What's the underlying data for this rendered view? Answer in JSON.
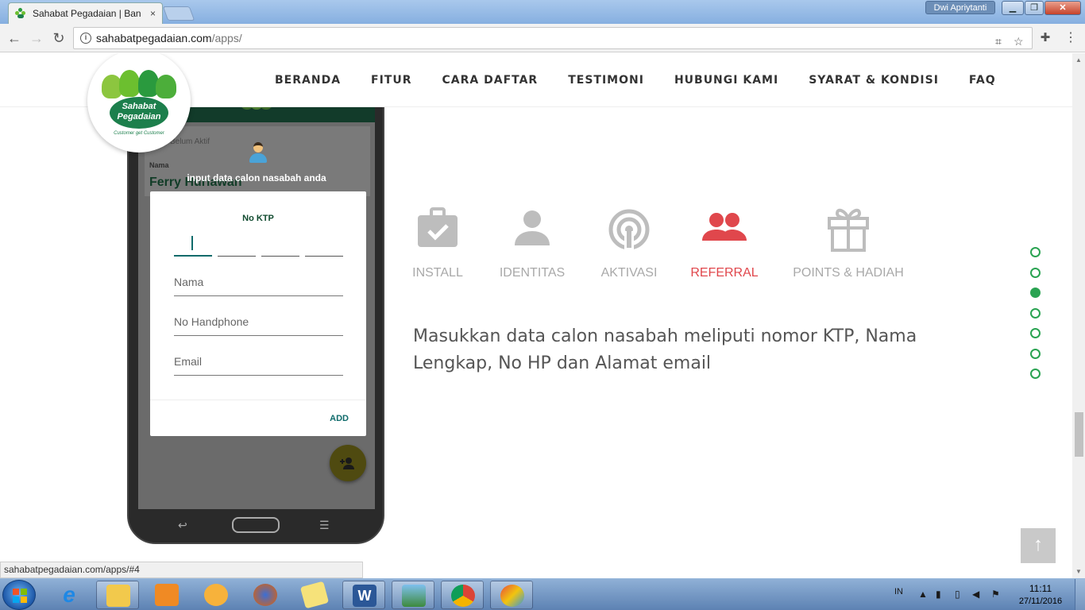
{
  "browser": {
    "tab_title": "Sahabat Pegadaian | Ban",
    "tab_close": "×",
    "profile_name": "Dwi Apriytanti",
    "url_host": "sahabatpegadaian.com",
    "url_path": "/apps/",
    "status_url": "sahabatpegadaian.com/apps/#4"
  },
  "nav": {
    "items": [
      "BERANDA",
      "FITUR",
      "CARA DAFTAR",
      "TESTIMONI",
      "HUBUNGI KAMI",
      "SYARAT & KONDISI",
      "FAQ"
    ]
  },
  "logo": {
    "line1": "Sahabat",
    "line2": "Pegadaian",
    "tagline": "Customer get Customer"
  },
  "phone": {
    "status": "Belum Aktif",
    "name_label": "Nama",
    "name_value": "Ferry Hurlawan",
    "hint": "input data calon nasabah anda",
    "dialog": {
      "ktp_label": "No KTP",
      "fields": [
        "Nama",
        "No Handphone",
        "Email"
      ],
      "add_label": "ADD"
    }
  },
  "steps": [
    {
      "label": "INSTALL",
      "icon": "briefcase-check-icon",
      "active": false
    },
    {
      "label": "IDENTITAS",
      "icon": "person-icon",
      "active": false
    },
    {
      "label": "AKTIVASI",
      "icon": "signal-icon",
      "active": false
    },
    {
      "label": "REFERRAL",
      "icon": "people-icon",
      "active": true
    },
    {
      "label": "POINTS & HADIAH",
      "icon": "gift-icon",
      "active": false
    }
  ],
  "description": "Masukkan data calon nasabah meliputi nomor KTP, Nama Lengkap, No HP dan Alamat email",
  "dot_nav": {
    "count": 7,
    "active_index": 2
  },
  "colors": {
    "accent_green": "#2aa352",
    "active_red": "#e0474c",
    "inactive_grey": "#a9a9a9"
  },
  "taskbar": {
    "lang": "IN",
    "time": "11:11",
    "date": "27/11/2016"
  }
}
